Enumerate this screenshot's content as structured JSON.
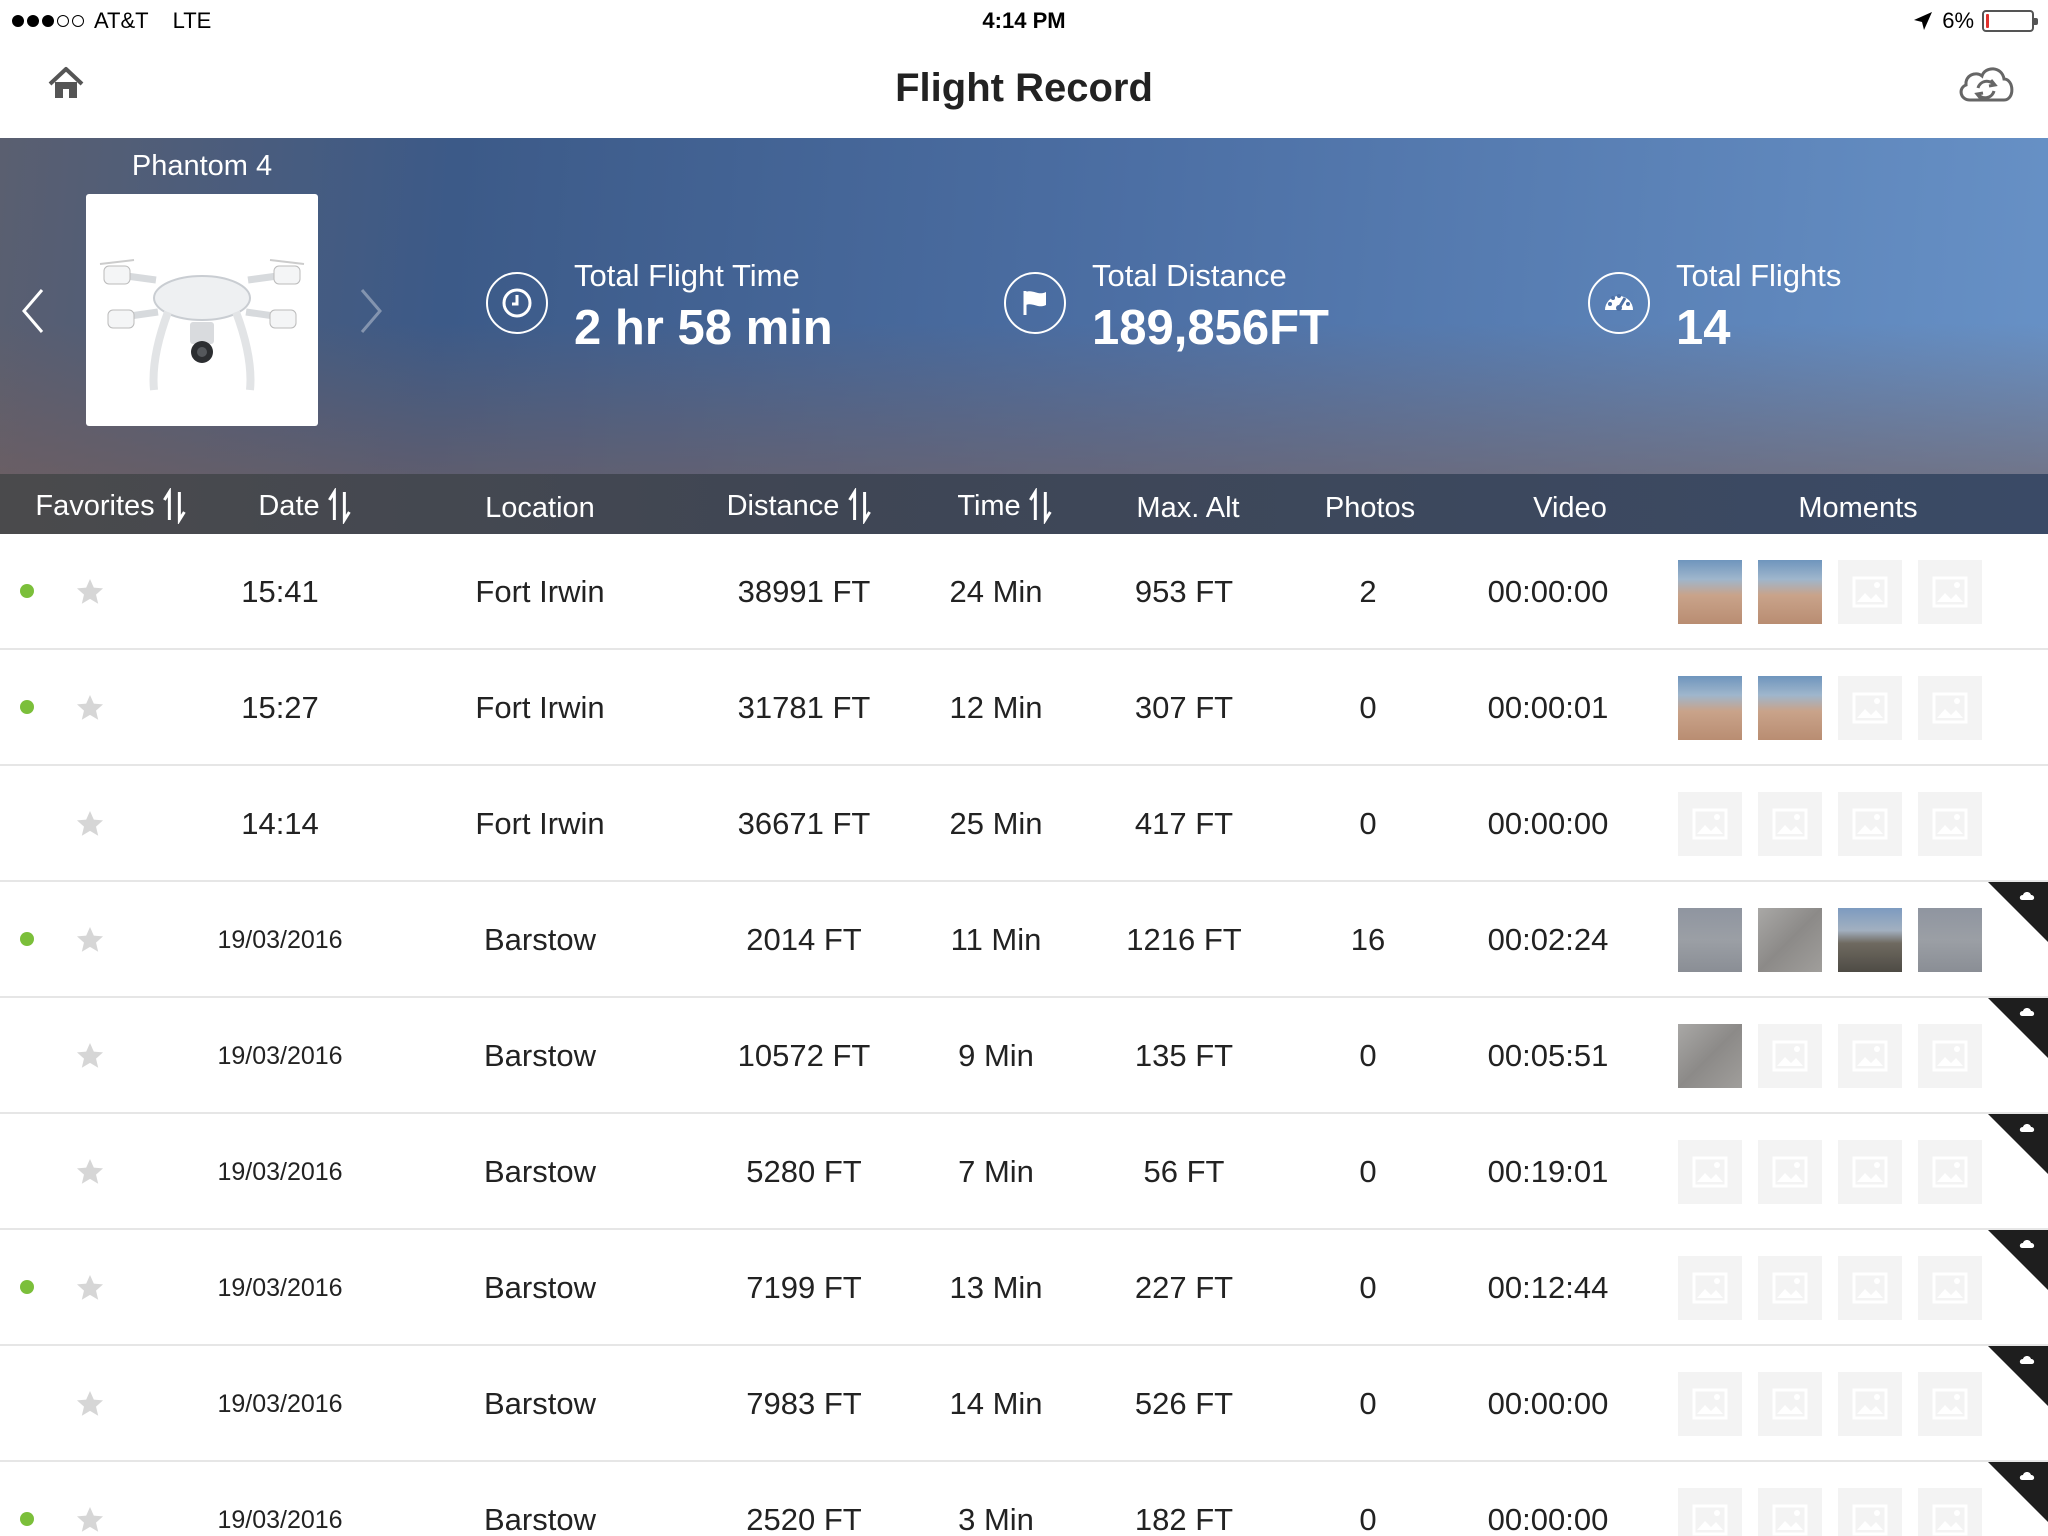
{
  "status_bar": {
    "carrier": "AT&T",
    "network": "LTE",
    "time": "4:14 PM",
    "battery": "6%",
    "battery_level": 0.06
  },
  "nav": {
    "title": "Flight Record",
    "home_icon": "home-icon",
    "sync_icon": "cloud-sync-icon"
  },
  "banner": {
    "aircraft_name": "Phantom 4",
    "stats": [
      {
        "label": "Total Flight Time",
        "value": "2 hr 58 min",
        "icon": "clock-icon"
      },
      {
        "label": "Total Distance",
        "value": "189,856FT",
        "icon": "flag-icon"
      },
      {
        "label": "Total Flights",
        "value": "14",
        "icon": "speedometer-icon"
      }
    ]
  },
  "columns": [
    "Favorites",
    "Date",
    "Location",
    "Distance",
    "Time",
    "Max. Alt",
    "Photos",
    "Video",
    "Moments"
  ],
  "rows": [
    {
      "synced": true,
      "date": "15:41",
      "location": "Fort Irwin",
      "distance": "38991 FT",
      "time": "24 Min",
      "max_alt": "953 FT",
      "photos": "2",
      "video": "00:00:00",
      "moments": [
        "photo",
        "photo",
        "placeholder",
        "placeholder"
      ],
      "cloud": false
    },
    {
      "synced": true,
      "date": "15:27",
      "location": "Fort Irwin",
      "distance": "31781 FT",
      "time": "12 Min",
      "max_alt": "307 FT",
      "photos": "0",
      "video": "00:00:01",
      "moments": [
        "photo",
        "photo",
        "placeholder",
        "placeholder"
      ],
      "cloud": false
    },
    {
      "synced": false,
      "date": "14:14",
      "location": "Fort Irwin",
      "distance": "36671 FT",
      "time": "25 Min",
      "max_alt": "417 FT",
      "photos": "0",
      "video": "00:00:00",
      "moments": [
        "placeholder",
        "placeholder",
        "placeholder",
        "placeholder"
      ],
      "cloud": false
    },
    {
      "synced": true,
      "date": "19/03/2016",
      "location": "Barstow",
      "distance": "2014 FT",
      "time": "11 Min",
      "max_alt": "1216 FT",
      "photos": "16",
      "video": "00:02:24",
      "moments": [
        "photo2",
        "photo4",
        "photo3",
        "photo2"
      ],
      "cloud": true
    },
    {
      "synced": false,
      "date": "19/03/2016",
      "location": "Barstow",
      "distance": "10572 FT",
      "time": "9 Min",
      "max_alt": "135 FT",
      "photos": "0",
      "video": "00:05:51",
      "moments": [
        "photo4",
        "placeholder",
        "placeholder",
        "placeholder"
      ],
      "cloud": true
    },
    {
      "synced": false,
      "date": "19/03/2016",
      "location": "Barstow",
      "distance": "5280 FT",
      "time": "7 Min",
      "max_alt": "56 FT",
      "photos": "0",
      "video": "00:19:01",
      "moments": [
        "placeholder",
        "placeholder",
        "placeholder",
        "placeholder"
      ],
      "cloud": true
    },
    {
      "synced": true,
      "date": "19/03/2016",
      "location": "Barstow",
      "distance": "7199 FT",
      "time": "13 Min",
      "max_alt": "227 FT",
      "photos": "0",
      "video": "00:12:44",
      "moments": [
        "placeholder",
        "placeholder",
        "placeholder",
        "placeholder"
      ],
      "cloud": true
    },
    {
      "synced": false,
      "date": "19/03/2016",
      "location": "Barstow",
      "distance": "7983 FT",
      "time": "14 Min",
      "max_alt": "526 FT",
      "photos": "0",
      "video": "00:00:00",
      "moments": [
        "placeholder",
        "placeholder",
        "placeholder",
        "placeholder"
      ],
      "cloud": true
    },
    {
      "synced": true,
      "date": "19/03/2016",
      "location": "Barstow",
      "distance": "2520 FT",
      "time": "3 Min",
      "max_alt": "182 FT",
      "photos": "0",
      "video": "00:00:00",
      "moments": [
        "placeholder",
        "placeholder",
        "placeholder",
        "placeholder"
      ],
      "cloud": true
    }
  ],
  "colors": {
    "sync_dot": "#7bbf3a",
    "battery_low": "#e0312d",
    "header_bar": "#3f4654"
  }
}
